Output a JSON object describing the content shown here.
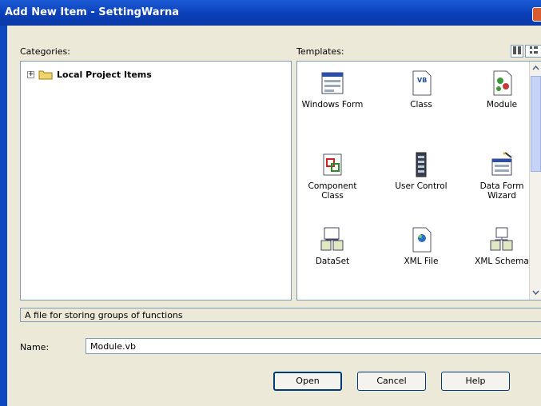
{
  "window": {
    "title": "Add New Item - SettingWarna"
  },
  "categories": {
    "label": "Categories:",
    "tree": [
      {
        "expander": "+",
        "label": "Local Project Items"
      }
    ]
  },
  "templates": {
    "label": "Templates:",
    "items": [
      {
        "label": "Windows Form",
        "icon": "windows-form-icon"
      },
      {
        "label": "Class",
        "icon": "vb-class-icon"
      },
      {
        "label": "Module",
        "icon": "module-icon",
        "selected": true
      },
      {
        "label": "Component Class",
        "icon": "component-class-icon"
      },
      {
        "label": "User Control",
        "icon": "user-control-icon"
      },
      {
        "label": "Data Form Wizard",
        "icon": "data-form-wizard-icon"
      },
      {
        "label": "DataSet",
        "icon": "dataset-icon"
      },
      {
        "label": "XML File",
        "icon": "xml-file-icon"
      },
      {
        "label": "XML Schema",
        "icon": "xml-schema-icon"
      }
    ]
  },
  "description": "A file for storing groups of functions",
  "name_field": {
    "label": "Name:",
    "value": "Module.vb"
  },
  "buttons": {
    "open": "Open",
    "cancel": "Cancel",
    "help": "Help"
  },
  "colors": {
    "titlebar": "#0a3fb8",
    "dialog": "#ece9d8",
    "border": "#7f9db9"
  }
}
